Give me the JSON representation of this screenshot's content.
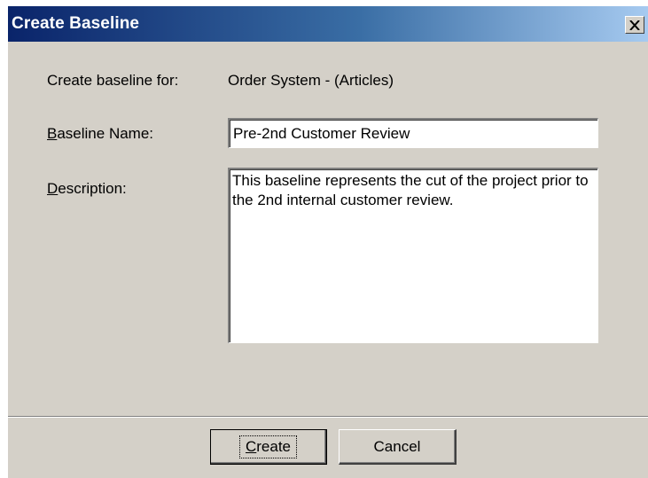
{
  "window": {
    "title": "Create Baseline",
    "close_icon": "close-icon"
  },
  "form": {
    "create_for_label": "Create baseline for:",
    "create_for_value": "Order System - (Articles)",
    "name_label_mnemonic": "B",
    "name_label_rest": "aseline Name:",
    "name_value": "Pre-2nd Customer Review",
    "description_label_mnemonic": "D",
    "description_label_rest": "escription:",
    "description_value": "This baseline represents the cut of the project prior to the 2nd internal customer review."
  },
  "buttons": {
    "create_mnemonic": "C",
    "create_rest": "reate",
    "cancel_label": "Cancel"
  },
  "colors": {
    "title_gradient_start": "#0a246a",
    "title_gradient_end": "#a6caf0",
    "dialog_background": "#d4d0c8"
  }
}
